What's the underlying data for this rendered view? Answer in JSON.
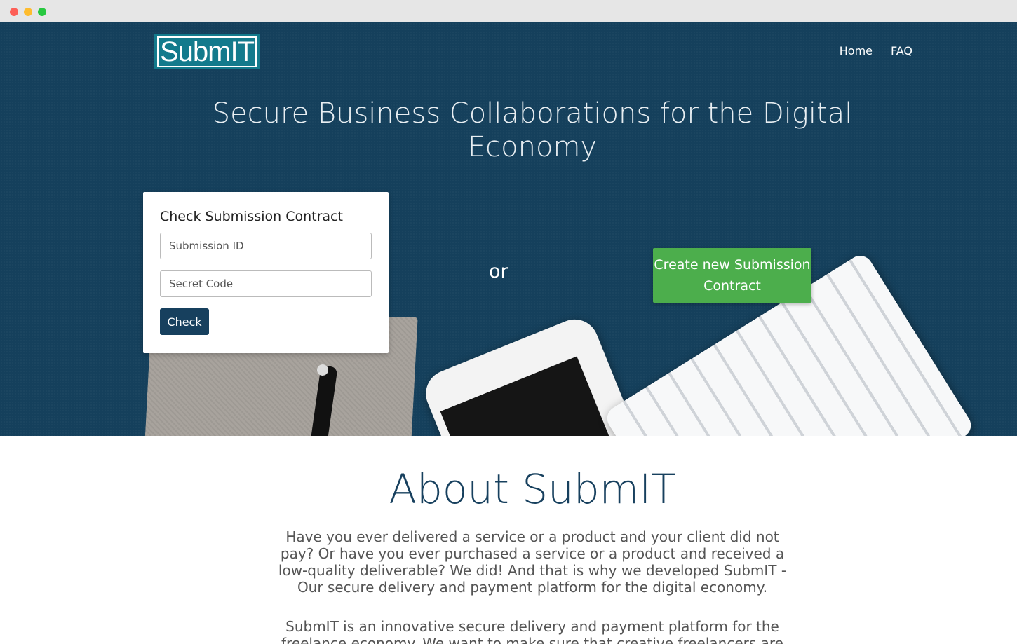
{
  "window": {
    "controls": [
      "close",
      "minimize",
      "maximize"
    ]
  },
  "header": {
    "logo_text": "SubmIT",
    "nav": [
      {
        "label": "Home"
      },
      {
        "label": "FAQ"
      }
    ]
  },
  "hero": {
    "title": "Secure Business Collaborations for the Digital Economy",
    "check_card": {
      "title": "Check Submission Contract",
      "submission_id_placeholder": "Submission ID",
      "secret_code_placeholder": "Secret Code",
      "check_label": "Check"
    },
    "or_label": "or",
    "create_label": "Create new Submission Contract"
  },
  "about": {
    "title": "About SubmIT",
    "paragraph1": "Have you ever delivered a service or a product and your client did not pay? Or have you ever purchased a service or a product and received a low-quality deliverable? We did! And that is why we developed SubmIT - Our secure delivery and payment platform for the digital economy.",
    "paragraph2": "SubmIT is an innovative secure delivery and payment platform for the freelance economy. We want to make sure that creative freelancers are"
  },
  "colors": {
    "hero_bg": "#15405c",
    "logo_bg": "#137a8c",
    "check_button": "#17405e",
    "create_button": "#4cae4c",
    "about_title": "#17405e"
  }
}
